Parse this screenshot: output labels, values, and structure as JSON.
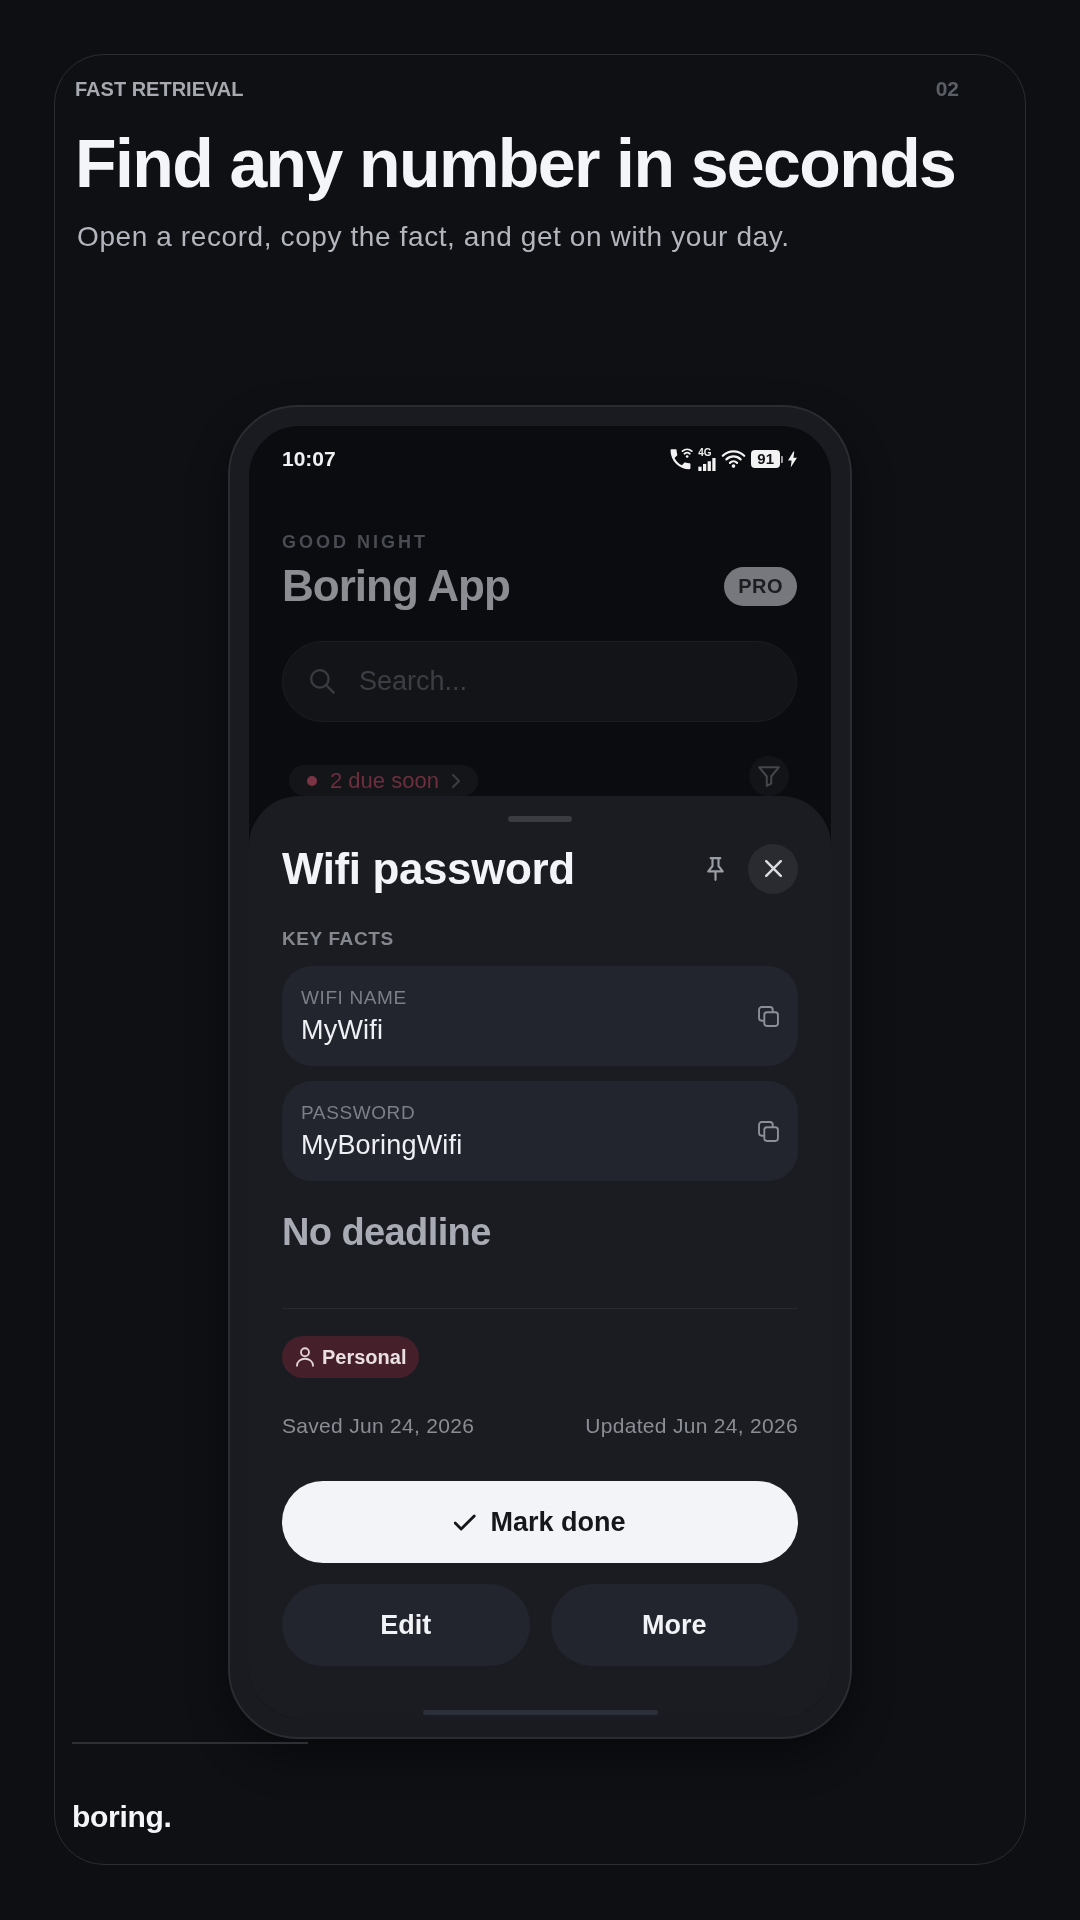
{
  "header": {
    "eyebrow": "FAST RETRIEVAL",
    "page_number": "02",
    "title": "Find any number in seconds",
    "subtitle": "Open a record, copy the fact, and get on with your day."
  },
  "phone": {
    "status_bar": {
      "time": "10:07",
      "network": "4G",
      "battery": "91"
    },
    "app": {
      "greeting": "GOOD NIGHT",
      "title": "Boring App",
      "badge": "PRO",
      "search": {
        "placeholder": "Search..."
      },
      "due_chip": {
        "label": "2 due soon"
      }
    },
    "sheet": {
      "title": "Wifi password",
      "section": "KEY FACTS",
      "facts": [
        {
          "label": "WIFI NAME",
          "value": "MyWifi"
        },
        {
          "label": "PASSWORD",
          "value": "MyBoringWifi"
        }
      ],
      "deadline": "No deadline",
      "tag": {
        "label": "Personal"
      },
      "saved": "Saved Jun 24, 2026",
      "updated": "Updated Jun 24, 2026",
      "actions": [
        {
          "label": "Mark done",
          "kind": "primary"
        },
        {
          "label": "Edit",
          "kind": "secondary"
        },
        {
          "label": "More",
          "kind": "secondary"
        }
      ]
    }
  },
  "footer": {
    "logo": "boring."
  }
}
